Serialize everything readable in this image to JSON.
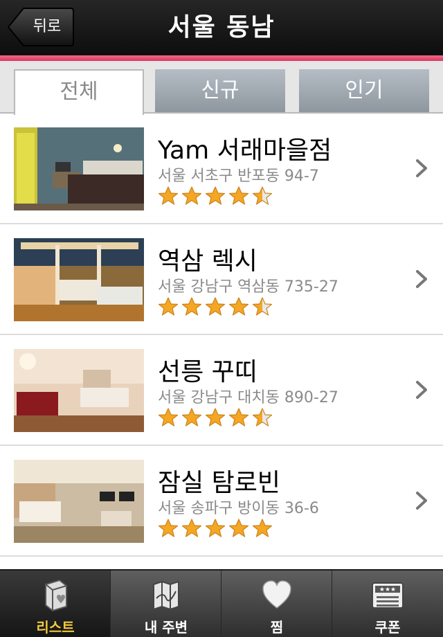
{
  "header": {
    "back_label": "뒤로",
    "title": "서울 동남"
  },
  "tabs": [
    {
      "label": "전체",
      "active": true
    },
    {
      "label": "신규",
      "active": false
    },
    {
      "label": "인기",
      "active": false
    }
  ],
  "listings": [
    {
      "name": "Yam 서래마을점",
      "address": "서울 서초구 반포동 94-7",
      "rating": 4.5
    },
    {
      "name": "역삼 렉시",
      "address": "서울 강남구 역삼동 735-27",
      "rating": 4.5
    },
    {
      "name": "선릉 꾸띠",
      "address": "서울 강남구 대치동 890-27",
      "rating": 4.5
    },
    {
      "name": "잠실 탐로빈",
      "address": "서울 송파구 방이동 36-6",
      "rating": 5
    }
  ],
  "tabbar": [
    {
      "label": "리스트",
      "icon": "list-box-icon",
      "selected": true
    },
    {
      "label": "내 주변",
      "icon": "map-icon",
      "selected": false
    },
    {
      "label": "찜",
      "icon": "heart-icon",
      "selected": false
    },
    {
      "label": "쿠폰",
      "icon": "coupon-icon",
      "selected": false
    }
  ],
  "colors": {
    "accent_pink": "#e2486f",
    "star_gold": "#f5a623",
    "selected_tab_label": "#f2c93a"
  }
}
